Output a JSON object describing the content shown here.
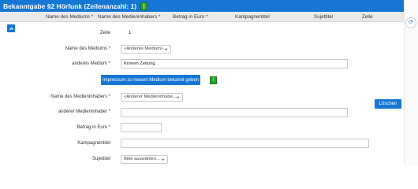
{
  "title": "Bekanntgabe §2 Hörfunk (Zeilenanzahl: 1)",
  "title_marker": "|",
  "columns": [
    "Name des Mediums *",
    "Name des Medieninhabers *",
    "Betrag in Euro *",
    "Kampagnentitel",
    "Sujettitel",
    "Zeile"
  ],
  "form": {
    "zeile_label": "Zeile",
    "zeile_value": "1",
    "medium_label": "Name des Mediums *",
    "medium_select": "«Anderes Medium»",
    "anderes_medium_label": "anderes Medium *",
    "anderes_medium_value": "Kronen Zeitung",
    "impressum_button": "Impressum zu neuem Medium bekannt geben",
    "impressum_marker": "i",
    "inhaber_label": "Name des Medieninhabers *",
    "inhaber_select": "«Anderer Medieninhabe...",
    "anderer_inhaber_label": "anderer Medieninhaber *",
    "anderer_inhaber_value": "",
    "betrag_label": "Betrag in Euro *",
    "betrag_value": "",
    "kampagne_label": "Kampagnentitel",
    "kampagne_value": "",
    "sujet_label": "Sujettitel",
    "sujet_select": "Bitte auswählen..."
  },
  "delete_button": "Löschen",
  "colors": {
    "primary": "#1577d3",
    "green": "#2e9e2e"
  }
}
